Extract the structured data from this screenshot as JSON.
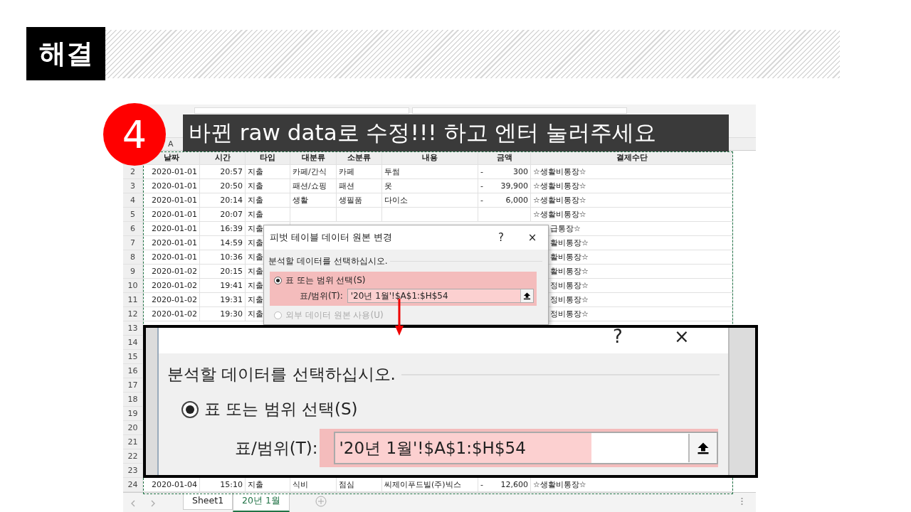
{
  "slide": {
    "heading": "해결",
    "step_badge": "4",
    "caption": "바뀐 raw data로 수정!!! 하고 엔터 눌러주세요"
  },
  "sheet": {
    "column_letters": [
      "A"
    ],
    "columns": [
      "날짜",
      "시간",
      "타입",
      "대분류",
      "소분류",
      "내용",
      "금액",
      "결제수단"
    ],
    "rows": [
      {
        "number": "2",
        "kind": "full",
        "date": "2020-01-01",
        "time": "20:57",
        "type": "지출",
        "major": "카페/간식",
        "minor": "카페",
        "content": "투썸",
        "sign": "-",
        "amount": "300",
        "payment": "☆생활비통장☆"
      },
      {
        "number": "3",
        "kind": "full",
        "date": "2020-01-01",
        "time": "20:50",
        "type": "지출",
        "major": "패션/쇼핑",
        "minor": "패션",
        "content": "옷",
        "sign": "-",
        "amount": "39,900",
        "payment": "☆생활비통장☆"
      },
      {
        "number": "4",
        "kind": "full",
        "date": "2020-01-01",
        "time": "20:14",
        "type": "지출",
        "major": "생활",
        "minor": "생필품",
        "content": "다이소",
        "sign": "-",
        "amount": "6,000",
        "payment": "☆생활비통장☆"
      },
      {
        "number": "5",
        "kind": "full",
        "date": "2020-01-01",
        "time": "20:07",
        "type": "지출",
        "payment": "☆생활비통장☆"
      },
      {
        "number": "6",
        "kind": "behind_dialog",
        "date": "2020-01-01",
        "time": "16:39",
        "type": "지출",
        "payment": "급통장☆"
      },
      {
        "number": "7",
        "kind": "behind_dialog",
        "date": "2020-01-01",
        "time": "14:59",
        "type": "지출",
        "payment": "활비통장☆"
      },
      {
        "number": "8",
        "kind": "behind_dialog",
        "date": "2020-01-01",
        "time": "10:36",
        "type": "지출",
        "payment": "활비통장☆"
      },
      {
        "number": "9",
        "kind": "behind_dialog",
        "date": "2020-01-02",
        "time": "20:15",
        "type": "지출",
        "payment": "활비통장☆"
      },
      {
        "number": "10",
        "kind": "behind_dialog",
        "date": "2020-01-02",
        "time": "19:41",
        "type": "지출",
        "payment": "정비통장☆"
      },
      {
        "number": "11",
        "kind": "behind_dialog",
        "date": "2020-01-02",
        "time": "19:31",
        "type": "지출",
        "payment": "정비통장☆"
      },
      {
        "number": "12",
        "kind": "behind_dialog",
        "date": "2020-01-02",
        "time": "19:30",
        "type": "지출",
        "payment": "정비통장☆"
      },
      {
        "number": "13",
        "kind": "behind_inset"
      },
      {
        "number": "14",
        "kind": "behind_inset"
      },
      {
        "number": "15",
        "kind": "behind_inset"
      },
      {
        "number": "16",
        "kind": "behind_inset"
      },
      {
        "number": "17",
        "kind": "behind_inset"
      },
      {
        "number": "18",
        "kind": "behind_inset"
      },
      {
        "number": "19",
        "kind": "behind_inset"
      },
      {
        "number": "20",
        "kind": "behind_inset"
      },
      {
        "number": "21",
        "kind": "behind_inset"
      },
      {
        "number": "22",
        "kind": "behind_inset"
      },
      {
        "number": "23",
        "kind": "behind_inset"
      },
      {
        "number": "24",
        "kind": "full",
        "date": "2020-01-04",
        "time": "15:10",
        "type": "지출",
        "major": "식비",
        "minor": "점심",
        "content": "씨제이푸드빌(주)빅스",
        "sign": "-",
        "amount": "12,600",
        "payment": "☆생활비통장☆"
      }
    ]
  },
  "dialog": {
    "title": "피벗 테이블 데이터 원본 변경",
    "help": "?",
    "close": "×",
    "prompt": "분석할 데이터를 선택하십시오.",
    "options": [
      {
        "label": "표 또는 범위 선택(S)",
        "selected": true,
        "disabled": false
      },
      {
        "label": "외부 데이터 원본 사용(U)",
        "selected": false,
        "disabled": true
      }
    ],
    "field_label": "표/범위(T):",
    "field_value": "'20년 1월'!$A$1:$H$54"
  },
  "zoom_inset": {
    "help": "?",
    "close": "×",
    "prompt": "분석할 데이터를 선택하십시오.",
    "option": {
      "label": "표 또는 범위 선택(S)",
      "selected": true
    },
    "field_label": "표/범위(T):",
    "field_value": "'20년 1월'!$A$1:$H$54"
  },
  "sheet_tabs": [
    {
      "label": "Sheet1",
      "selected": false
    },
    {
      "label": "20년 1월",
      "selected": true
    }
  ]
}
